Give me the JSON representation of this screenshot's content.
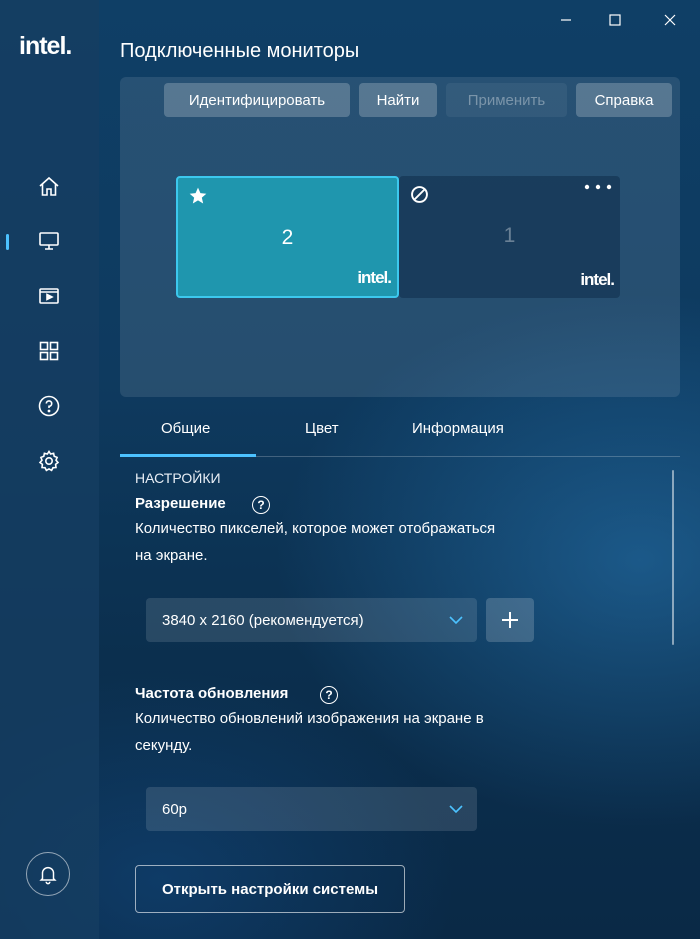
{
  "app": {
    "logo_text": "intel.",
    "page_title": "Подключенные мониторы"
  },
  "sidebar": {
    "items": [
      {
        "icon": "home-icon"
      },
      {
        "icon": "monitor-icon",
        "active": true
      },
      {
        "icon": "video-icon"
      },
      {
        "icon": "apps-grid-icon"
      },
      {
        "icon": "help-circle-icon"
      },
      {
        "icon": "gear-icon"
      }
    ],
    "bell_icon": "bell-icon"
  },
  "toolbar": {
    "identify_label": "Идентифицировать",
    "find_label": "Найти",
    "apply_label": "Применить",
    "help_label": "Справка"
  },
  "monitors": [
    {
      "number": "2",
      "brand": "intel.",
      "primary": true,
      "badge_icon": "star-icon"
    },
    {
      "number": "1",
      "brand": "intel.",
      "primary": false,
      "badge_icon": "disabled-icon",
      "menu_icon": "more-dots-icon"
    }
  ],
  "tabs": [
    {
      "label": "Общие",
      "active": true
    },
    {
      "label": "Цвет"
    },
    {
      "label": "Информация"
    }
  ],
  "settings": {
    "section_title": "НАСТРОЙКИ",
    "resolution": {
      "label": "Разрешение",
      "desc_line1": "Количество пикселей, которое может отображаться",
      "desc_line2": "на экране.",
      "value": "3840 x 2160 (рекомендуется)"
    },
    "refresh": {
      "label": "Частота обновления",
      "desc_line1": "Количество обновлений изображения на экране в",
      "desc_line2": "секунду.",
      "value": "60p"
    },
    "open_system_settings_label": "Открыть настройки системы"
  },
  "colors": {
    "accent": "#4cc2ff",
    "primary_monitor": "#1f96ae"
  }
}
